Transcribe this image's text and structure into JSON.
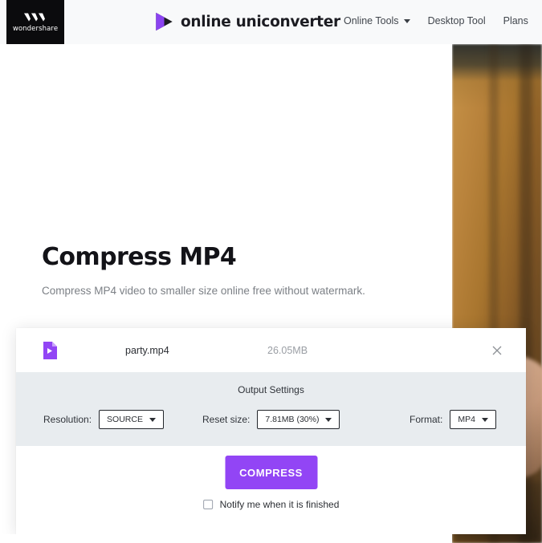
{
  "header": {
    "brand": {
      "name": "wondershare",
      "mark_icon": "wondershare-w-icon"
    },
    "logo": {
      "icon": "play-triangle-icon",
      "text": "online uniconverter"
    },
    "nav": [
      {
        "label": "Online Tools",
        "has_caret": true,
        "icon": "chevron-down-icon"
      },
      {
        "label": "Desktop Tool",
        "has_caret": false
      },
      {
        "label": "Plans",
        "has_caret": false
      }
    ]
  },
  "hero": {
    "title": "Compress MP4",
    "subtitle": "Compress MP4 video to smaller size online free without watermark.",
    "photo_alt": "background-photo"
  },
  "card": {
    "file": {
      "icon": "video-file-icon",
      "name": "party.mp4",
      "size": "26.05MB",
      "close_icon": "close-icon"
    },
    "settings": {
      "title": "Output Settings",
      "fields": [
        {
          "label": "Resolution:",
          "value": "SOURCE",
          "icon": "chevron-down-icon"
        },
        {
          "label": "Reset size:",
          "value": "7.81MB (30%)",
          "icon": "chevron-down-icon"
        },
        {
          "label": "Format:",
          "value": "MP4",
          "icon": "chevron-down-icon"
        }
      ]
    },
    "actions": {
      "compress_label": "COMPRESS",
      "notify_label": "Notify me when it is finished",
      "notify_checked": false
    }
  },
  "colors": {
    "accent_purple": "#9245f5",
    "header_bg": "#f8f9fa",
    "settings_bg": "#e8ecef",
    "brand_black": "#0b0b0d",
    "muted_text": "#9a9ea4"
  }
}
